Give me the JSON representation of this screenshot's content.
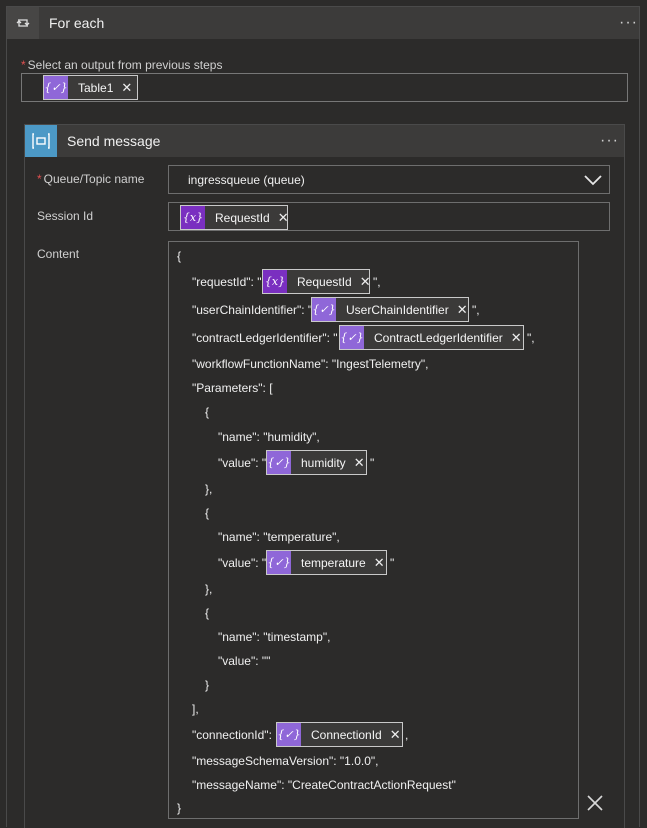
{
  "foreach": {
    "title": "For each",
    "more": "···",
    "input_label": "Select an output from previous steps",
    "input_token": "Table1"
  },
  "send_message": {
    "title": "Send message",
    "more": "···",
    "queue_label": "Queue/Topic name",
    "queue_value": "ingressqueue (queue)",
    "session_label": "Session Id",
    "session_token": "RequestId",
    "content_label": "Content"
  },
  "content": {
    "l1": "{",
    "requestId_key": "\"requestId\": \"",
    "requestId_token": "RequestId",
    "requestId_end": "\",",
    "userChain_key": "\"userChainIdentifier\": \"",
    "userChain_token": "UserChainIdentifier",
    "userChain_end": "\",",
    "contractLedger_key": "\"contractLedgerIdentifier\": \"",
    "contractLedger_token": "ContractLedgerIdentifier",
    "contractLedger_end": "\",",
    "workflow_line": "\"workflowFunctionName\": \"IngestTelemetry\",",
    "params_line": "\"Parameters\": [",
    "open_brace": "{",
    "name_humidity": "\"name\": \"humidity\",",
    "value_key": "\"value\": \"",
    "humidity_token": "humidity",
    "value_end": "\"",
    "close_brace_comma": "},",
    "name_temperature": "\"name\": \"temperature\",",
    "temperature_token": "temperature",
    "name_timestamp": "\"name\": \"timestamp\",",
    "value_empty": "\"value\": \"\"",
    "close_brace": "}",
    "close_bracket": "],",
    "connection_key": "\"connectionId\":",
    "connection_token": "ConnectionId",
    "connection_end": ",",
    "schema_line": "\"messageSchemaVersion\": \"1.0.0\",",
    "messagename_line": "\"messageName\": \"CreateContractActionRequest\"",
    "final_close": "}"
  },
  "icons": {
    "foreach": "loop-icon",
    "send": "service-bus-icon",
    "token_light": "expression-icon",
    "token_dark": "variable-icon",
    "remove": "close-icon",
    "dropdown": "chevron-down-icon"
  },
  "colors": {
    "background": "#2c2b2a",
    "header": "#3c3b3a",
    "token_light": "#8f67d8",
    "token_dark": "#7a2fc0",
    "send_icon": "#4c99c6",
    "required": "#e05050"
  }
}
